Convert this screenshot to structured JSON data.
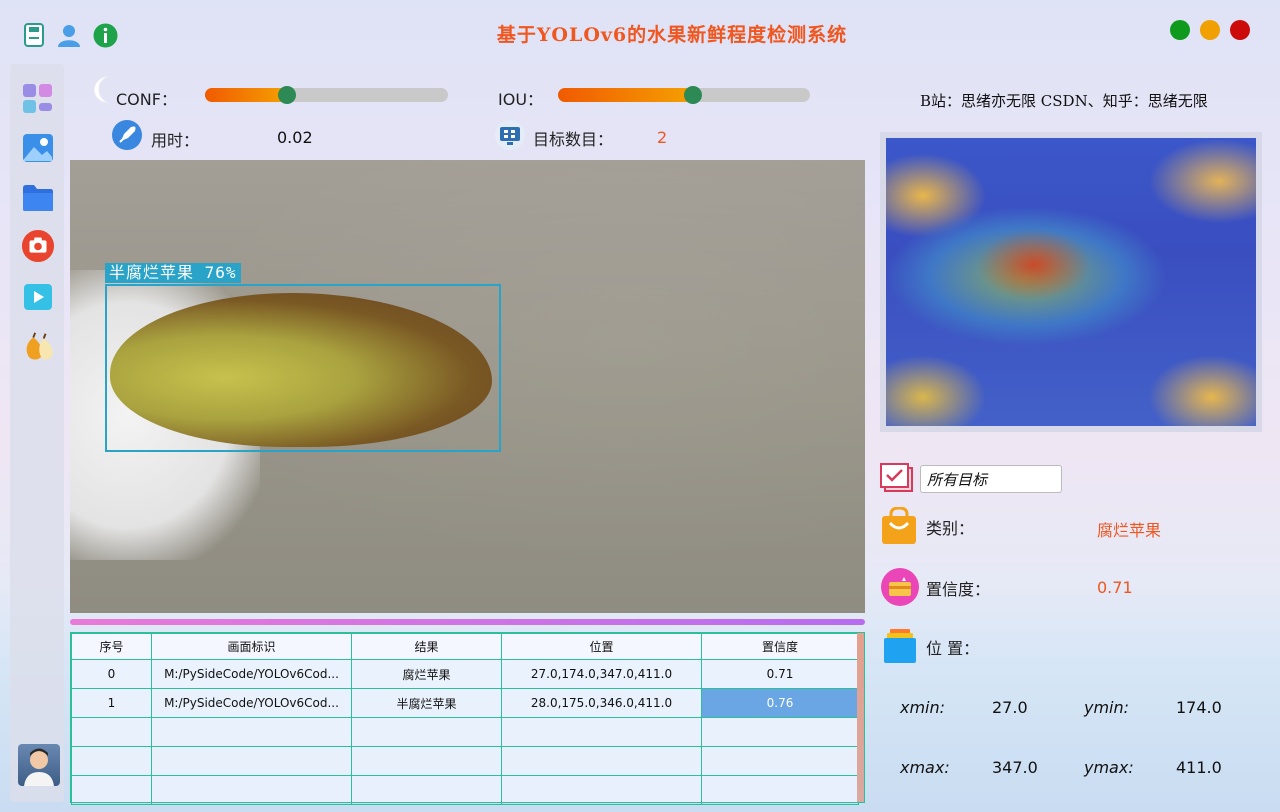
{
  "app": {
    "title": "基于YOLOv6的水果新鲜程度检测系统",
    "credit": "B站：思绪亦无限 CSDN、知乎：思绪无限"
  },
  "window_buttons": {
    "close_color": "#cc0a0a",
    "minimize_color": "#f0a000",
    "maximize_color": "#0f9a1e"
  },
  "toolbar": {
    "icons": [
      "save-icon",
      "user-icon",
      "info-icon"
    ]
  },
  "sidebar": {
    "items": [
      "dashboard-icon",
      "image-icon",
      "folder-icon",
      "camera-icon",
      "video-icon",
      "fruit-icon"
    ]
  },
  "controls": {
    "conf_label": "CONF：",
    "conf_value": 0.3,
    "iou_label": "IOU：",
    "iou_value": 0.5,
    "time_label": "用时：",
    "time_value": "0.02",
    "count_label": "目标数目：",
    "count_value": "2"
  },
  "detection": {
    "box_label": "半腐烂苹果 76%"
  },
  "table": {
    "headers": [
      "序号",
      "画面标识",
      "结果",
      "位置",
      "置信度"
    ],
    "rows": [
      [
        "0",
        "M:/PySideCode/YOLOv6Cod...",
        "腐烂苹果",
        "27.0,174.0,347.0,411.0",
        "0.71"
      ],
      [
        "1",
        "M:/PySideCode/YOLOv6Cod...",
        "半腐烂苹果",
        "28.0,175.0,346.0,411.0",
        "0.76"
      ],
      [
        "",
        "",
        "",
        "",
        ""
      ],
      [
        "",
        "",
        "",
        "",
        ""
      ],
      [
        "",
        "",
        "",
        "",
        ""
      ]
    ]
  },
  "result": {
    "target_select": "所有目标",
    "class_label": "类别：",
    "class_value": "腐烂苹果",
    "conf_label": "置信度：",
    "conf_value": "0.71",
    "pos_label": "位 置：",
    "xmin_label": "xmin:",
    "xmin_value": "27.0",
    "ymin_label": "ymin:",
    "ymin_value": "174.0",
    "xmax_label": "xmax:",
    "xmax_value": "347.0",
    "ymax_label": "ymax:",
    "ymax_value": "411.0"
  }
}
